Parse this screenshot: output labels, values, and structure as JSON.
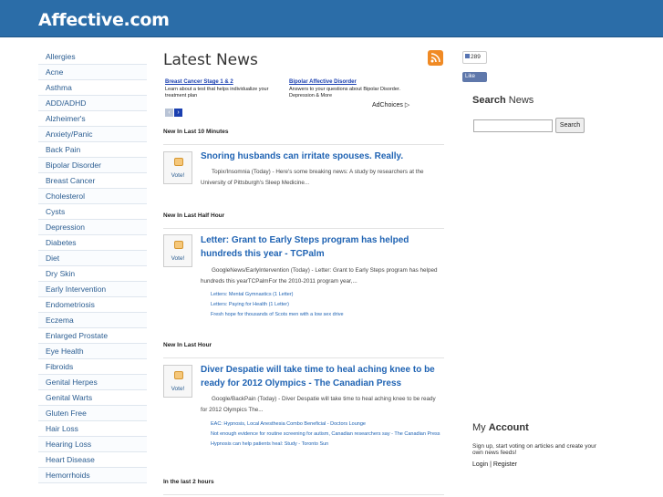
{
  "site": {
    "title": "Affective.com"
  },
  "sidebar": {
    "items": [
      {
        "label": "Allergies"
      },
      {
        "label": "Acne"
      },
      {
        "label": "Asthma"
      },
      {
        "label": "ADD/ADHD"
      },
      {
        "label": "Alzheimer's"
      },
      {
        "label": "Anxiety/Panic"
      },
      {
        "label": "Back Pain"
      },
      {
        "label": "Bipolar Disorder"
      },
      {
        "label": "Breast Cancer"
      },
      {
        "label": "Cholesterol"
      },
      {
        "label": "Cysts"
      },
      {
        "label": "Depression"
      },
      {
        "label": "Diabetes"
      },
      {
        "label": "Diet"
      },
      {
        "label": "Dry Skin"
      },
      {
        "label": "Early Intervention"
      },
      {
        "label": "Endometriosis"
      },
      {
        "label": "Eczema"
      },
      {
        "label": "Enlarged Prostate"
      },
      {
        "label": "Eye Health"
      },
      {
        "label": "Fibroids"
      },
      {
        "label": "Genital Herpes"
      },
      {
        "label": "Genital Warts"
      },
      {
        "label": "Gluten Free"
      },
      {
        "label": "Hair Loss"
      },
      {
        "label": "Hearing Loss"
      },
      {
        "label": "Heart Disease"
      },
      {
        "label": "Hemorrhoids"
      }
    ]
  },
  "main": {
    "title": "Latest News",
    "ads": [
      {
        "title": "Breast Cancer Stage 1 & 2",
        "text": "Learn about a test that helps individualize your treatment plan"
      },
      {
        "title": "Bipolar Affective Disorder",
        "text": "Answers to your questions about Bipolar Disorder. Depression & More"
      }
    ],
    "adchoices": "AdChoices",
    "sections": [
      {
        "heading": "New In Last 10 Minutes",
        "vote": "Vote!",
        "headline": "Snoring husbands can irritate spouses. Really.",
        "summary": "Topix/Insomnia (Today) - Here's some breaking news: A study by researchers at the University of Pittsburgh's Sleep Medicine...",
        "related": []
      },
      {
        "heading": "New In Last Half Hour",
        "vote": "Vote!",
        "headline": "Letter: Grant to Early Steps program has helped hundreds this year - TCPalm",
        "summary": "GoogleNews/EarlyIntervention (Today) - Letter: Grant to Early Steps program has helped hundreds this yearTCPalmFor the 2010-2011 program year,...",
        "related": [
          "Letters: Mental Gymnastics (1 Letter)",
          "Letters: Paying for Health (1 Letter)",
          "Fresh hope for thousands of Scots men with a low sex drive"
        ]
      },
      {
        "heading": "New In Last Hour",
        "vote": "Vote!",
        "headline": "Diver Despatie will take time to heal aching knee to be ready for 2012 Olympics - The Canadian Press",
        "summary": "Google/BackPain (Today) - Diver Despatie will take time to heal aching knee to be ready for 2012 Olympics The...",
        "related": [
          "EAC: Hypnosis, Local Anesthesia Combo Beneficial - Doctors Lounge",
          "Not enough evidence for routine screening for autism, Canadian researchers say - The Canadian Press",
          "Hypnosis can help patients heal: Study - Toronto Sun"
        ]
      },
      {
        "heading": "In the last 2 hours"
      }
    ]
  },
  "right": {
    "like_count": "289",
    "like_label": "Like",
    "search_title_bold": "Search",
    "search_title_rest": " News",
    "search_button": "Search",
    "account_title_pre": "My ",
    "account_title_bold": "Account",
    "account_desc": "Sign up, start voting on articles and create your own news feeds!",
    "login": "Login",
    "separator": " | ",
    "register": "Register"
  }
}
